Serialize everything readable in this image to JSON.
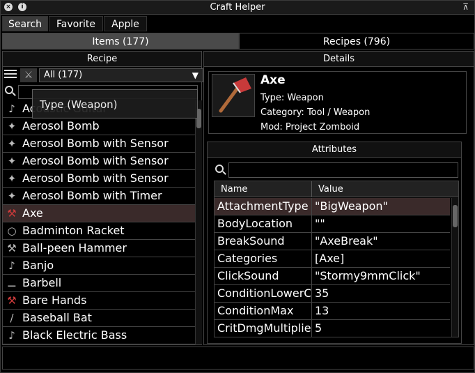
{
  "window": {
    "title": "Craft Helper"
  },
  "top_tabs": [
    "Search",
    "Favorite",
    "Apple"
  ],
  "mid_tabs": {
    "items": "Items (177)",
    "recipes": "Recipes (796)"
  },
  "left": {
    "header": "Recipe",
    "filter_value": "All (177)",
    "tooltip": "Type (Weapon)",
    "items": [
      {
        "label": "Acoustic Guitar",
        "icon": "guitar-icon",
        "glyph": "♪"
      },
      {
        "label": "Aerosol Bomb",
        "icon": "aerosol-bomb-icon",
        "glyph": "✦"
      },
      {
        "label": "Aerosol Bomb with Sensor",
        "icon": "aerosol-bomb-icon",
        "glyph": "✦"
      },
      {
        "label": "Aerosol Bomb with Sensor",
        "icon": "aerosol-bomb-icon",
        "glyph": "✦"
      },
      {
        "label": "Aerosol Bomb with Sensor",
        "icon": "aerosol-bomb-icon",
        "glyph": "✦"
      },
      {
        "label": "Aerosol Bomb with Timer",
        "icon": "aerosol-bomb-icon",
        "glyph": "✦"
      },
      {
        "label": "Axe",
        "icon": "axe-icon",
        "glyph": "⚒"
      },
      {
        "label": "Badminton Racket",
        "icon": "racket-icon",
        "glyph": "○"
      },
      {
        "label": "Ball-peen Hammer",
        "icon": "hammer-icon",
        "glyph": "⚒"
      },
      {
        "label": "Banjo",
        "icon": "banjo-icon",
        "glyph": "♪"
      },
      {
        "label": "Barbell",
        "icon": "barbell-icon",
        "glyph": "⚊"
      },
      {
        "label": "Bare Hands",
        "icon": "bare-hands-icon",
        "glyph": "⚒"
      },
      {
        "label": "Baseball Bat",
        "icon": "bat-icon",
        "glyph": "/"
      },
      {
        "label": "Black Electric Bass",
        "icon": "bass-guitar-icon",
        "glyph": "♪"
      }
    ]
  },
  "right": {
    "header": "Details",
    "item_name": "Axe",
    "type_line": "Type: Weapon",
    "category_line": "Category: Tool / Weapon",
    "mod_line": "Mod: Project Zomboid",
    "attributes_header": "Attributes",
    "columns": {
      "name": "Name",
      "value": "Value"
    },
    "rows": [
      {
        "name": "AttachmentType",
        "value": "\"BigWeapon\""
      },
      {
        "name": "BodyLocation",
        "value": "\"\""
      },
      {
        "name": "BreakSound",
        "value": "\"AxeBreak\""
      },
      {
        "name": "Categories",
        "value": "[Axe]"
      },
      {
        "name": "ClickSound",
        "value": "\"Stormy9mmClick\""
      },
      {
        "name": "ConditionLowerChance",
        "value": "35"
      },
      {
        "name": "ConditionMax",
        "value": "13"
      },
      {
        "name": "CritDmgMultiplier",
        "value": "5"
      }
    ]
  },
  "colors": {
    "selected_row": "#3a2a2a",
    "axe_red": "#c83a3a"
  }
}
